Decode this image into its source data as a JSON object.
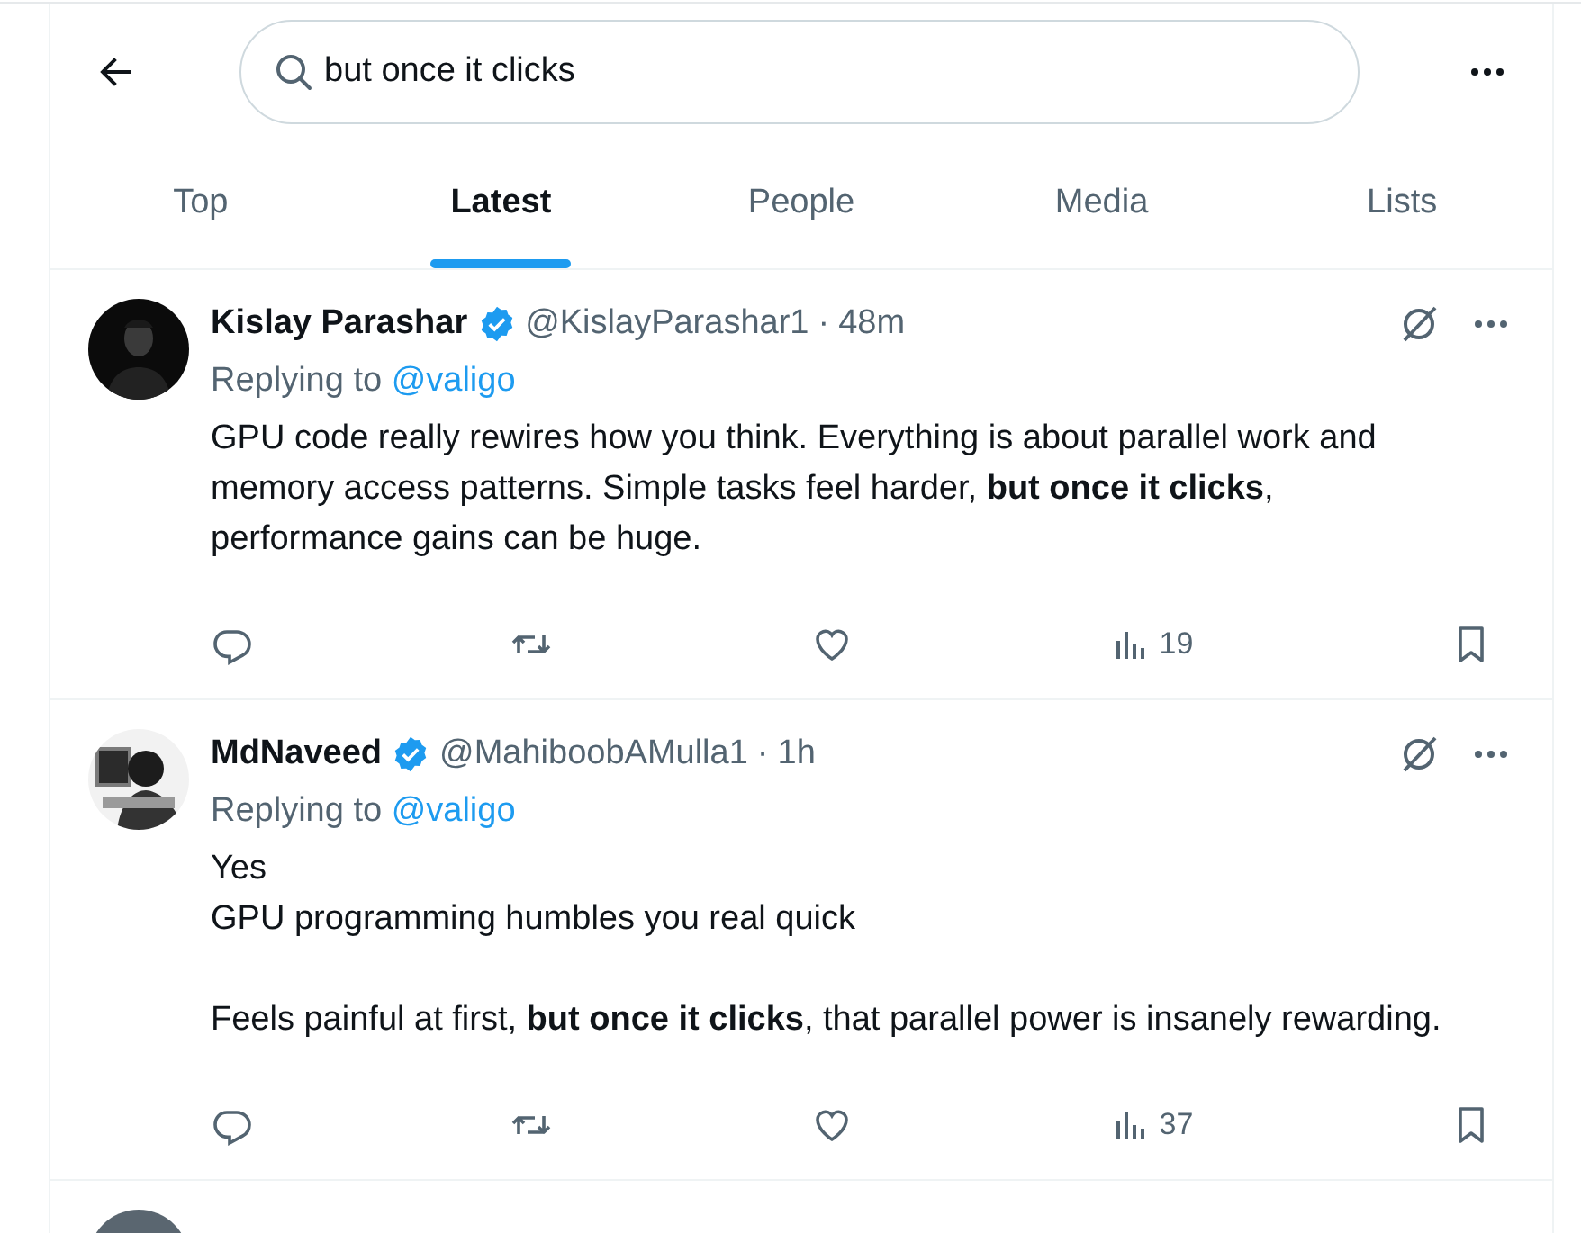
{
  "search": {
    "value": "but once it clicks"
  },
  "tabs": [
    {
      "label": "Top",
      "selected": false
    },
    {
      "label": "Latest",
      "selected": true
    },
    {
      "label": "People",
      "selected": false
    },
    {
      "label": "Media",
      "selected": false
    },
    {
      "label": "Lists",
      "selected": false
    }
  ],
  "tweets": [
    {
      "name": "Kislay Parashar",
      "verified": true,
      "handle": "@KislayParashar1",
      "separator": "·",
      "time": "48m",
      "replying_label": "Replying to",
      "replying_to": "@valigo",
      "paragraphs": [
        "GPU code really rewires how you think. Everything is about parallel work and memory access patterns. Simple tasks feel harder, **but once it clicks**, performance gains can be huge."
      ],
      "views": "19",
      "avatar": {
        "kind": "picture"
      }
    },
    {
      "name": "MdNaveed",
      "verified": true,
      "handle": "@MahiboobAMulla1",
      "separator": "·",
      "time": "1h",
      "replying_label": "Replying to",
      "replying_to": "@valigo",
      "paragraphs": [
        "Yes\nGPU programming humbles you real quick",
        "Feels painful at first, **but once it clicks**, that parallel power is insanely rewarding."
      ],
      "views": "37",
      "avatar": {
        "kind": "picture"
      }
    }
  ]
}
